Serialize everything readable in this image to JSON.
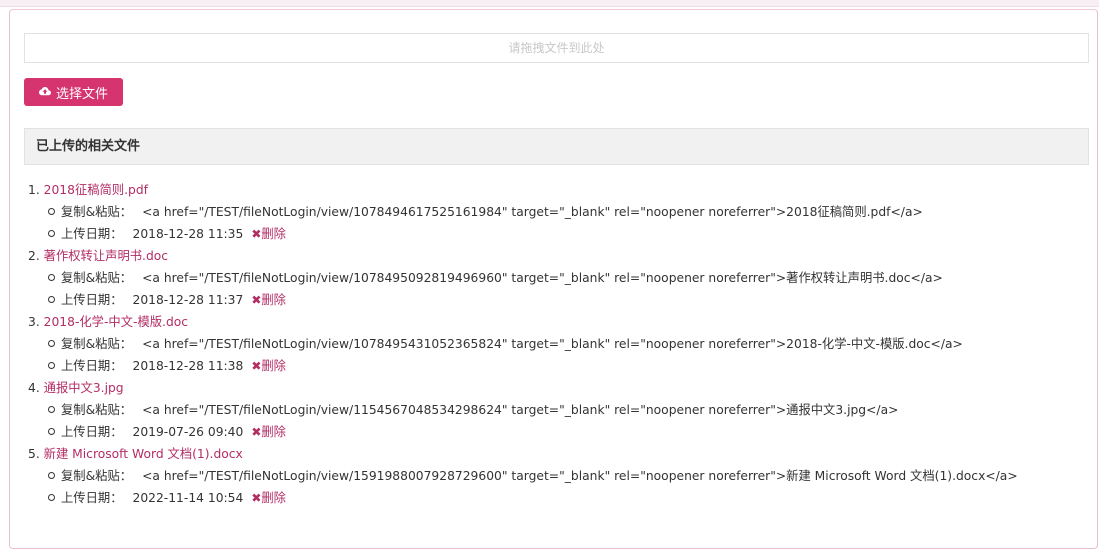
{
  "upload": {
    "drop_placeholder": "请拖拽文件到此处",
    "choose_button": "选择文件"
  },
  "section_title": "已上传的相关文件",
  "labels": {
    "copy_paste": "复制&粘贴：",
    "upload_date": "上传日期：",
    "delete": "删除"
  },
  "files": [
    {
      "number": "1.",
      "name": "2018征稿简则.pdf",
      "code": "<a href=\"/TEST/fileNotLogin/view/1078494617525161984\" target=\"_blank\" rel=\"noopener noreferrer\">2018征稿简则.pdf</a>",
      "date": "2018-12-28 11:35"
    },
    {
      "number": "2.",
      "name": "著作权转让声明书.doc",
      "code": "<a href=\"/TEST/fileNotLogin/view/1078495092819496960\" target=\"_blank\" rel=\"noopener noreferrer\">著作权转让声明书.doc</a>",
      "date": "2018-12-28 11:37"
    },
    {
      "number": "3.",
      "name": "2018-化学-中文-模版.doc",
      "code": "<a href=\"/TEST/fileNotLogin/view/1078495431052365824\" target=\"_blank\" rel=\"noopener noreferrer\">2018-化学-中文-模版.doc</a>",
      "date": "2018-12-28 11:38"
    },
    {
      "number": "4.",
      "name": "通报中文3.jpg",
      "code": "<a href=\"/TEST/fileNotLogin/view/1154567048534298624\" target=\"_blank\" rel=\"noopener noreferrer\">通报中文3.jpg</a>",
      "date": "2019-07-26 09:40"
    },
    {
      "number": "5.",
      "name": "新建 Microsoft Word 文档(1).docx",
      "code": "<a href=\"/TEST/fileNotLogin/view/1591988007928729600\" target=\"_blank\" rel=\"noopener noreferrer\">新建 Microsoft Word 文档(1).docx</a>",
      "date": "2022-11-14 10:54"
    }
  ],
  "colors": {
    "accent": "#d6346f",
    "link": "#b32d65",
    "heading_bg": "#f1f1f1"
  },
  "icons": {
    "choose_button_icon": "cloud-upload-icon",
    "delete_icon": "close-icon"
  }
}
